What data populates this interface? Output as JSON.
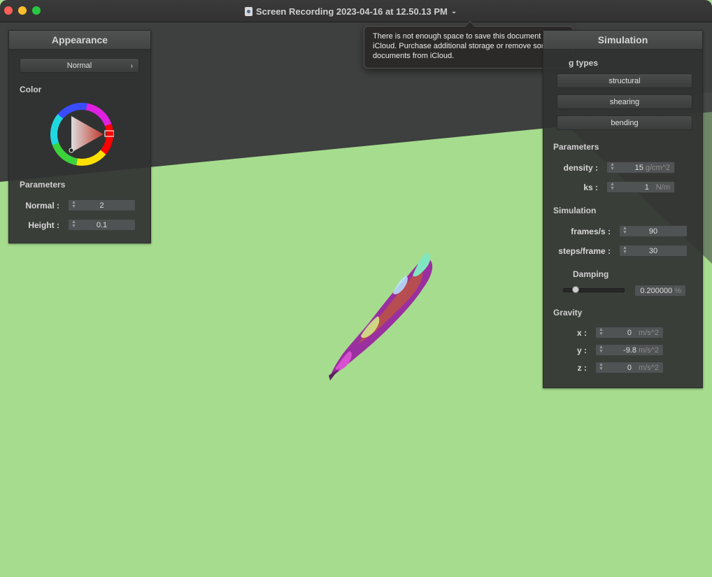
{
  "window": {
    "title": "Screen Recording 2023-04-16 at 12.50.13 PM",
    "doc_icon": "document-icon",
    "title_chevron": "⌄"
  },
  "tooltip": {
    "message": "There is not enough space to save this document to iCloud. Purchase additional storage or remove some documents from iCloud."
  },
  "appearance_panel": {
    "title": "Appearance",
    "shader_select": {
      "value": "Normal",
      "arrow": "›"
    },
    "color_label": "Color",
    "selected_color": "#c0392b",
    "parameters_label": "Parameters",
    "params": [
      {
        "label": "Normal :",
        "value": "2"
      },
      {
        "label": "Height :",
        "value": "0.1"
      }
    ]
  },
  "simulation_panel": {
    "title": "Simulation",
    "spring_types_label": "g types",
    "spring_buttons": [
      "structural",
      "shearing",
      "bending"
    ],
    "parameters_label": "Parameters",
    "parameters": [
      {
        "label": "density :",
        "value": "15",
        "unit": "g/cm^2"
      },
      {
        "label": "ks :",
        "value": "1",
        "unit": "N/m"
      }
    ],
    "simulation_label": "Simulation",
    "simulation": [
      {
        "label": "frames/s :",
        "value": "90"
      },
      {
        "label": "steps/frame :",
        "value": "30"
      }
    ],
    "damping_label": "Damping",
    "damping": {
      "value": "0.200000",
      "unit": "%",
      "slider_fraction": 0.2
    },
    "gravity_label": "Gravity",
    "gravity": [
      {
        "label": "x :",
        "value": "0",
        "unit": "m/s^2"
      },
      {
        "label": "y :",
        "value": "-9.8",
        "unit": "m/s^2"
      },
      {
        "label": "z :",
        "value": "0",
        "unit": "m/s^2"
      }
    ]
  },
  "colors": {
    "ground": "#a6dc8e",
    "background": "#3e3f3f",
    "cloth_primary": "#9a2fa0"
  }
}
